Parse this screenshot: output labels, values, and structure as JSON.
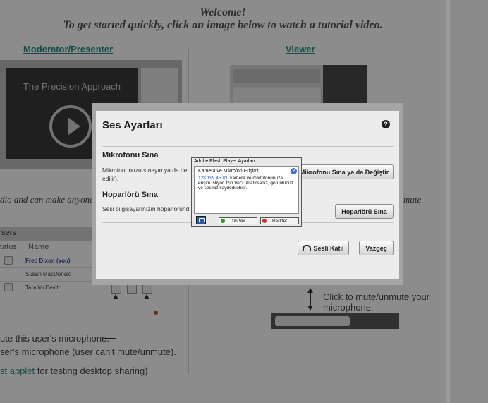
{
  "background": {
    "welcome_line1": "Welcome!",
    "welcome_line2": "To get started quickly, click an image below to watch a tutorial video.",
    "moderator_link": "Moderator/Presenter",
    "viewer_link": "Viewer",
    "video_title": "The Precision Approach",
    "side_text_left": "dio and can make anyone",
    "side_text_right": "mute",
    "users_header": "sers",
    "columns": {
      "status": "tatus",
      "name": "Name"
    },
    "users": [
      {
        "name": "Fred Dixon (you)"
      },
      {
        "name": "Susan MacDonald"
      },
      {
        "name": "Tara McDevitt"
      }
    ],
    "annotation_mute_user": "ute this user's microphone.",
    "annotation_mic": "ser's microphone (user can't mute/unmute).",
    "annotation_applet_link": "st applet",
    "annotation_applet_rest": " for testing desktop sharing)",
    "annotation_click_line1": "Click to mute/unmute your",
    "annotation_click_line2": "microphone."
  },
  "dialog": {
    "title": "Ses Ayarları",
    "help_symbol": "?",
    "mic_section": {
      "heading": "Mikrofonu Sına",
      "text_line1": "Mikrofonunuzu sınayın ya da de",
      "text_line2": "edilir).",
      "button": "Mikrofonu Sına ya da Değiştir"
    },
    "speaker_section": {
      "heading": "Hoparlörü Sına",
      "text": "Sesi bilgisayarınızın hoparlöründ",
      "button": "Hoparlörü Sına"
    },
    "join_audio_button": "Sesli Katıl",
    "cancel_button": "Vazgeç"
  },
  "flash": {
    "title": "Adobe Flash Player Ayarları",
    "heading": "Kamera ve Mikrofon Erişimi",
    "help_symbol": "?",
    "ip": "128.199.45.83",
    "text_after_ip": ", kamera ve mikrofonunuza",
    "text_rest": "erişim istiyor. İzin Ver'i tıklatırsanız, görüntünüz ve sesiniz kaydedilebilir.",
    "allow_button": "İzin Ver",
    "deny_button": "Reddet"
  }
}
